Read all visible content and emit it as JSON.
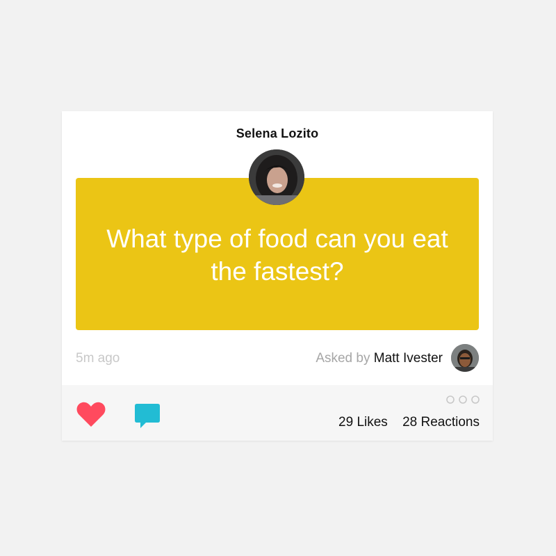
{
  "post": {
    "author_name": "Selena Lozito",
    "question": "What type of food can you eat the fastest?",
    "time_ago": "5m ago",
    "asked_by_prefix": "Asked by",
    "asker_name": "Matt Ivester"
  },
  "footer": {
    "likes": "29 Likes",
    "reactions": "28 Reactions"
  },
  "icons": {
    "like": "heart-icon",
    "comment": "speech-bubble-icon",
    "more": "more-options-icon"
  },
  "colors": {
    "question_bg": "#ebc515",
    "heart": "#ff4a5e",
    "comment": "#22bcd4"
  }
}
